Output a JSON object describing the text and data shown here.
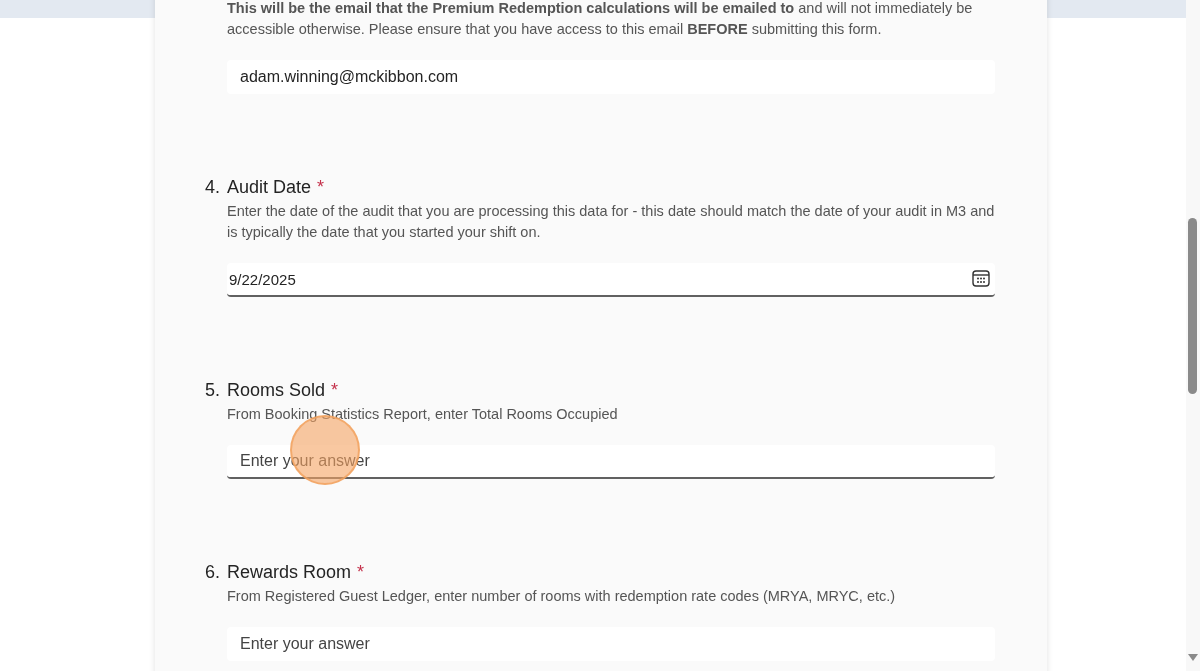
{
  "questions": [
    {
      "description": "**This will be the email that the Premium Redemption calculations will be emailed to** and will not immediately be accessible otherwise. Please ensure that you have access to this email **BEFORE** submitting this form.",
      "field": {
        "kind": "text",
        "value": "adam.winning@mckibbon.com",
        "hovered": false
      }
    },
    {
      "number": "4.",
      "title": "Audit Date",
      "required_mark": "*",
      "description": "Enter the date of the audit that you are processing this data for - this date should match the date of your audit in M3 and is typically the date that you started your shift on.",
      "field": {
        "kind": "date",
        "value": "9/22/2025",
        "hovered": true
      }
    },
    {
      "number": "5.",
      "title": "Rooms Sold",
      "required_mark": "*",
      "description": "From Booking Statistics Report, enter Total Rooms Occupied",
      "field": {
        "kind": "text",
        "placeholder": "Enter your answer",
        "hovered": true
      }
    },
    {
      "number": "6.",
      "title": "Rewards Room",
      "required_mark": "*",
      "description": "From Registered Guest Ledger, enter number of rooms with redemption rate codes (MRYA, MRYC, etc.)",
      "field": {
        "kind": "text",
        "placeholder": "Enter your answer",
        "hovered": false
      }
    }
  ]
}
